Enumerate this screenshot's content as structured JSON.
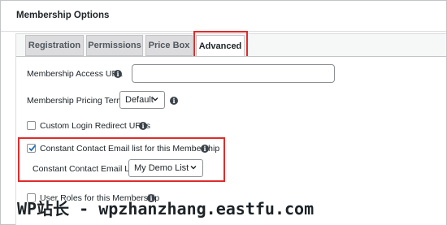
{
  "panel": {
    "title": "Membership Options"
  },
  "tabs": [
    {
      "label": "Registration",
      "active": false
    },
    {
      "label": "Permissions",
      "active": false
    },
    {
      "label": "Price Box",
      "active": false
    },
    {
      "label": "Advanced",
      "active": true
    }
  ],
  "fields": {
    "access_url": {
      "label": "Membership Access URL",
      "value": "",
      "placeholder": ""
    },
    "pricing_terms": {
      "label": "Membership Pricing Terms:",
      "selected": "Default"
    },
    "custom_login": {
      "label": "Custom Login Redirect URLs",
      "checked": false
    },
    "constant_contact": {
      "label": "Constant Contact Email list for this Membership",
      "checked": true
    },
    "email_list": {
      "label": "Constant Contact Email List:",
      "selected": "My Demo List"
    },
    "user_roles": {
      "label": "User Roles for this Membership",
      "checked": false
    }
  },
  "watermark": {
    "text": "WP站长 - wpzhanzhang.eastfu.com"
  },
  "colors": {
    "highlight": "#e02b2b",
    "check": "#2271b1"
  }
}
